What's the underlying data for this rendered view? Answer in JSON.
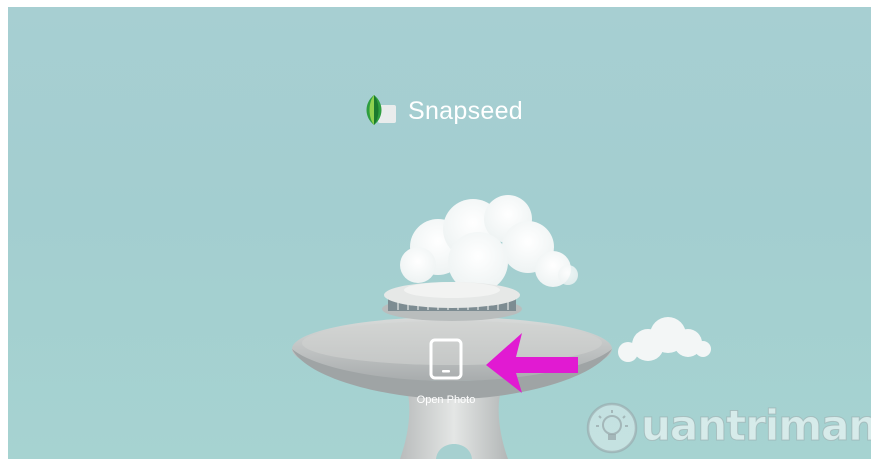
{
  "app": {
    "title": "Snapseed",
    "logo_icon": "snapseed-leaf-icon"
  },
  "main": {
    "open_photo_label": "Open Photo",
    "open_photo_icon": "tablet-icon"
  },
  "annotation": {
    "arrow_icon": "arrow-left-icon",
    "arrow_color": "#e11ad2"
  },
  "watermark": {
    "text": "uantrimang",
    "icon": "lightbulb-icon"
  },
  "colors": {
    "sky": "#a7cfd2",
    "tower": "#c9cbcb"
  }
}
